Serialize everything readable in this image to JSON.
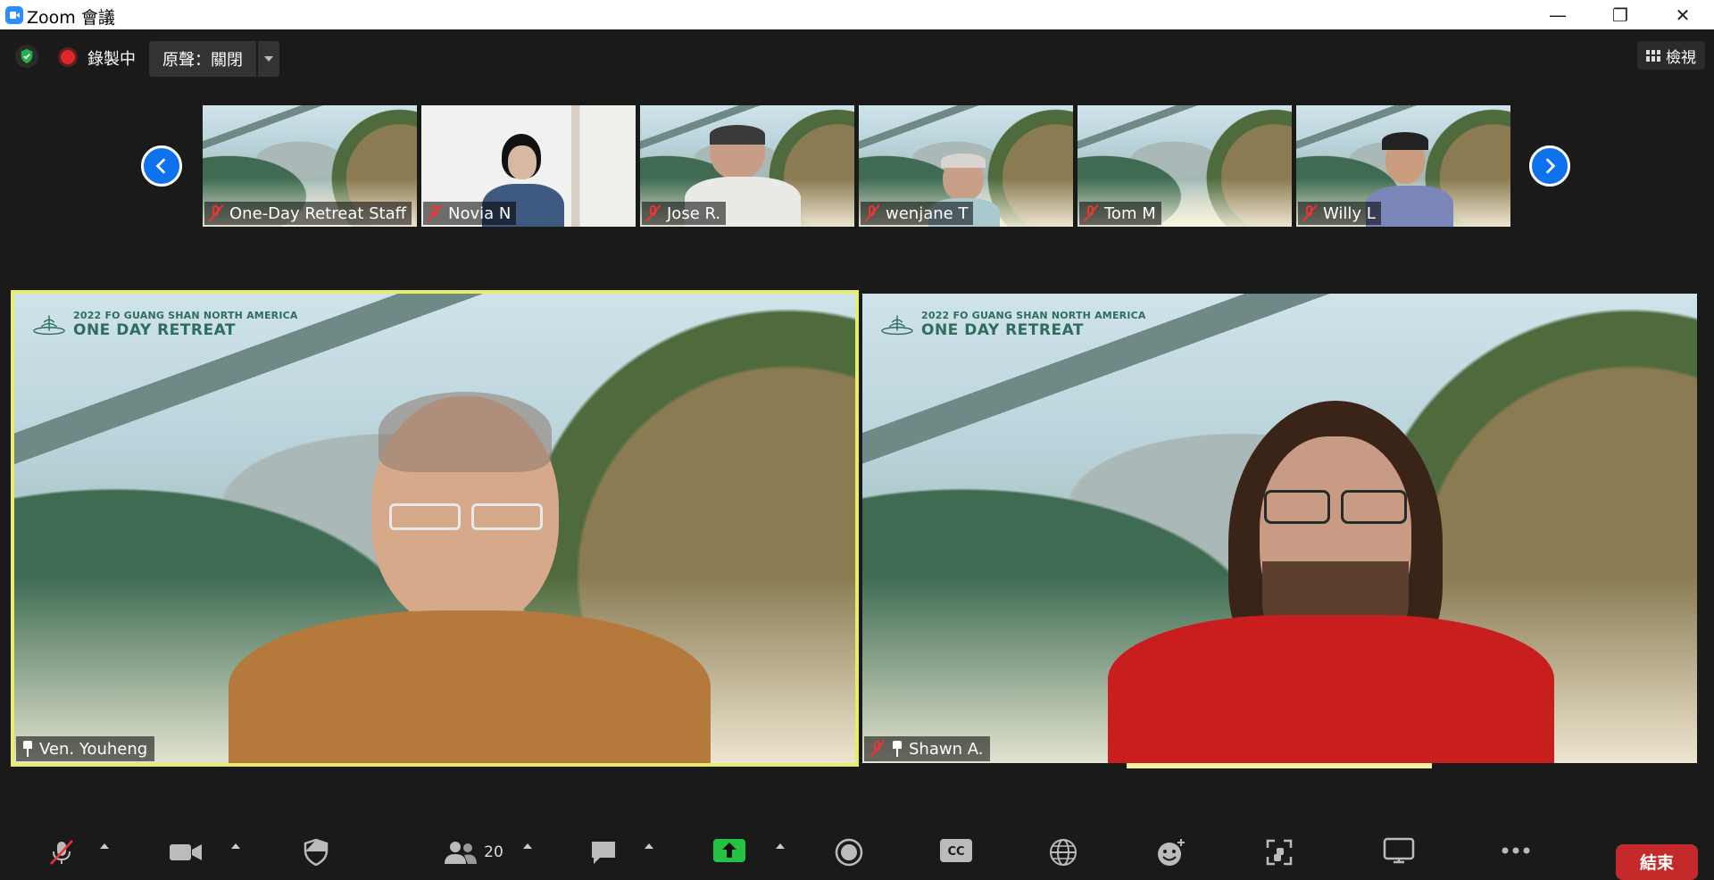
{
  "window": {
    "title": "Zoom 會議",
    "controls": {
      "minimize": "—",
      "restore": "❐",
      "close": "✕"
    }
  },
  "topbar": {
    "recording_text": "錄製中",
    "original_sound_label": "原聲：關閉",
    "view_label": "檢視"
  },
  "thumbnails": [
    {
      "name": "One-Day Retreat Staff",
      "muted": true,
      "background": "mountain"
    },
    {
      "name": "Novia N",
      "muted": true,
      "background": "room"
    },
    {
      "name": "Jose R.",
      "muted": true,
      "background": "mountain"
    },
    {
      "name": "wenjane T",
      "muted": true,
      "background": "mountain"
    },
    {
      "name": "Tom M",
      "muted": true,
      "background": "mountain"
    },
    {
      "name": "Willy L",
      "muted": true,
      "background": "mountain"
    }
  ],
  "main_tiles": [
    {
      "name": "Ven. Youheng",
      "muted": false,
      "pinned": true,
      "active_speaker": true,
      "brand_small": "2022 FO GUANG SHAN NORTH AMERICA",
      "brand_large": "ONE DAY RETREAT"
    },
    {
      "name": "Shawn A.",
      "muted": true,
      "pinned": true,
      "active_speaker": false,
      "brand_small": "2022 FO GUANG SHAN NORTH AMERICA",
      "brand_large": "ONE DAY RETREAT"
    }
  ],
  "toolbar": {
    "participants_count": "20",
    "end_label": "結束",
    "items": [
      "mic-muted-icon",
      "video-icon",
      "security-icon",
      "participants-icon",
      "chat-icon",
      "share-screen-icon",
      "record-icon",
      "cc-icon",
      "globe-icon",
      "reactions-icon",
      "apps-icon",
      "whiteboard-icon",
      "more-icon"
    ]
  },
  "colors": {
    "accent_blue": "#0e72ed",
    "active_speaker": "#e6ed6a",
    "share_green": "#23c343",
    "end_red": "#c42a2a",
    "mute_red": "#e33333"
  }
}
